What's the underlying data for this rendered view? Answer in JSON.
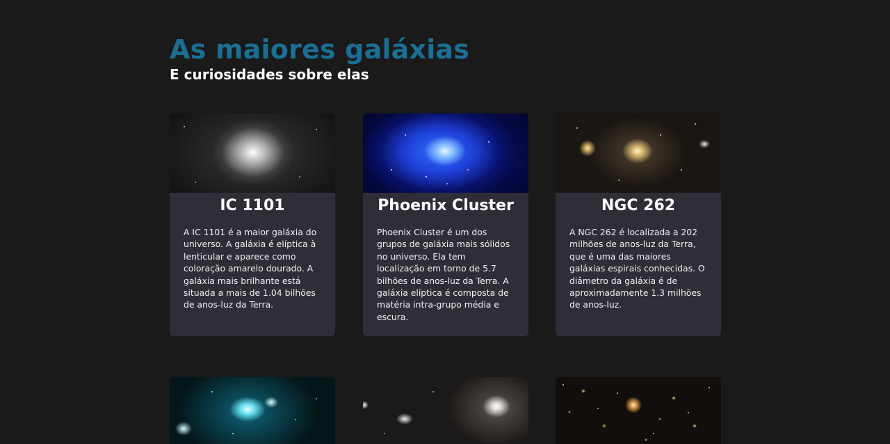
{
  "header": {
    "title": "As maiores galáxias",
    "subtitle": "E curiosidades sobre elas"
  },
  "colors": {
    "background": "#1a1a1a",
    "title": "#1a6f94",
    "card": "#2f2e37",
    "text": "#ffffff"
  },
  "cards": [
    {
      "name": "IC 1101",
      "description": "A IC 1101 é a maior galáxia do universo. A galáxia é elíptica à lenticular e aparece como coloração amarelo dourado. A galáxia mais brilhante está situada a mais de 1.04 bilhões de anos-luz da Terra.",
      "image": "ic-1101-galaxy-image"
    },
    {
      "name": "Phoenix Cluster",
      "description": "Phoenix Cluster é um dos grupos de galáxia mais sólidos no universo. Ela tem localização em torno de 5.7 bilhões de anos-luz da Terra. A galáxia elíptica é composta de matéria intra-grupo média e escura.",
      "image": "phoenix-cluster-galaxy-image"
    },
    {
      "name": "NGC 262",
      "description": "A NGC 262 é localizada a 202 milhões de anos-luz da Terra, que é uma das maiores galáxias espirais conhecidas. O diâmetro da galáxia é de aproximadamente 1.3 milhões de anos-luz.",
      "image": "ngc-262-galaxy-image"
    },
    {
      "image": "cyan-galaxy-cluster-image"
    },
    {
      "image": "elliptical-galaxy-pair-image"
    },
    {
      "image": "galaxy-field-image"
    }
  ]
}
